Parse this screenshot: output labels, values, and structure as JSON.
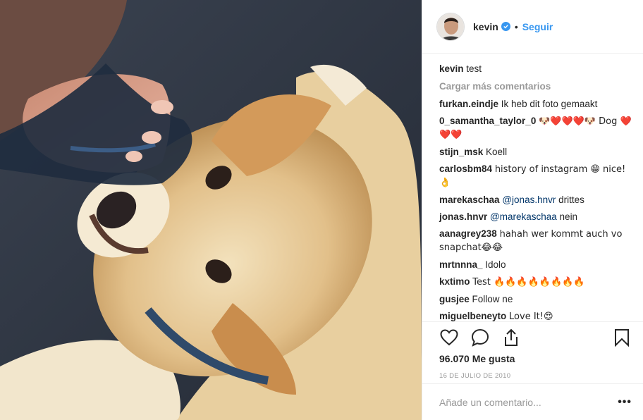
{
  "header": {
    "username": "kevin",
    "separator": "•",
    "follow_label": "Seguir",
    "verified_icon": "verified-badge-icon",
    "accent": "#3897f0"
  },
  "caption": {
    "username": "kevin",
    "text": "test"
  },
  "load_more_label": "Cargar más comentarios",
  "comments": [
    {
      "user": "furkan.eindje",
      "text": "Ik heb dit foto gemaakt"
    },
    {
      "user": "0_samantha_taylor_0",
      "text": "🐶❤️❤️❤️🐶 Dog ❤️❤️❤️"
    },
    {
      "user": "stijn_msk",
      "text": "Koell"
    },
    {
      "user": "carlosbm84",
      "text": "history of instagram 😁 nice! 👌"
    },
    {
      "user": "marekaschaa",
      "mention": "@jonas.hnvr",
      "text": "drittes"
    },
    {
      "user": "jonas.hnvr",
      "mention": "@marekaschaa",
      "text": "nein"
    },
    {
      "user": "aanagrey238",
      "text": "hahah wer kommt auch vo snapchat😂😂"
    },
    {
      "user": "mrtnnna_",
      "text": "Idolo"
    },
    {
      "user": "kxtimo",
      "text": "Test 🔥🔥🔥🔥🔥🔥🔥🔥"
    },
    {
      "user": "gusjee",
      "text": "Follow ne"
    },
    {
      "user": "miguelbeneyto",
      "text": "Love It!😍"
    }
  ],
  "actions": {
    "like_icon": "heart-icon",
    "comment_icon": "comment-icon",
    "share_icon": "share-icon",
    "save_icon": "bookmark-icon"
  },
  "likes_label": "96.070 Me gusta",
  "date_label": "16 DE JULIO DE 2010",
  "add_comment": {
    "placeholder": "Añade un comentario...",
    "more_label": "•••"
  }
}
